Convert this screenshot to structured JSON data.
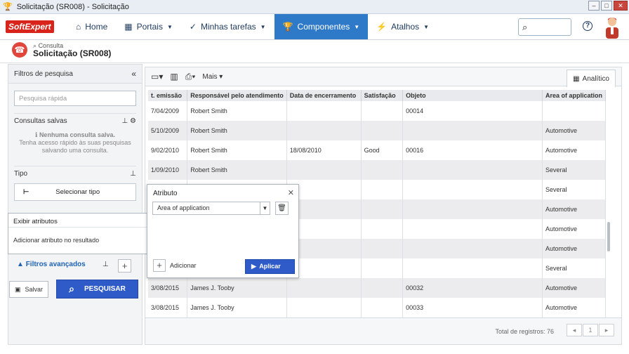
{
  "window": {
    "title": "Solicitação (SR008) - Solicitação"
  },
  "nav": {
    "logo": "SoftExpert",
    "home": "Home",
    "portais": "Portais",
    "tarefas": "Minhas tarefas",
    "componentes": "Componentes",
    "atalhos": "Atalhos"
  },
  "header": {
    "sub": "Consulta",
    "title": "Solicitação (SR008)"
  },
  "left": {
    "title": "Filtros de pesquisa",
    "quick_placeholder": "Pesquisa rápida",
    "saved": "Consultas salvas",
    "none_saved": "Nenhuma consulta salva.",
    "hint1": "Tenha acesso rápido às suas pesquisas",
    "hint2": "salvando uma consulta.",
    "tipo": "Tipo",
    "select_type": "Selecionar tipo",
    "advanced": "Filtros avançados",
    "save": "Salvar",
    "search": "PESQUISAR"
  },
  "toolbar": {
    "more": "Mais",
    "tab": "Analítico"
  },
  "table": {
    "headers": [
      "t. emissão",
      "Responsável pelo atendimento",
      "Data de encerramento",
      "Satisfação",
      "Objeto",
      "Area of application"
    ],
    "rows": [
      [
        "7/04/2009",
        "Robert Smith",
        "",
        "",
        "00014",
        ""
      ],
      [
        "5/10/2009",
        "Robert Smith",
        "",
        "",
        "",
        "Automotive"
      ],
      [
        "9/02/2010",
        "Robert Smith",
        "18/08/2010",
        "Good",
        "00016",
        "Automotive"
      ],
      [
        "1/09/2010",
        "Robert Smith",
        "",
        "",
        "",
        "Several"
      ],
      [
        "",
        "",
        "",
        "",
        "",
        "Several"
      ],
      [
        "",
        "",
        "",
        "",
        "",
        "Automotive"
      ],
      [
        "",
        "",
        "",
        "",
        "",
        "Automotive"
      ],
      [
        "",
        "",
        "",
        "",
        "",
        "Automotive"
      ],
      [
        "",
        "",
        "",
        "",
        "",
        "Several"
      ],
      [
        "3/08/2015",
        "James J. Tooby",
        "",
        "",
        "00032",
        "Automotive"
      ],
      [
        "3/08/2015",
        "James J. Tooby",
        "",
        "",
        "00033",
        "Automotive"
      ]
    ]
  },
  "footer": {
    "total": "Total de registros: 76",
    "page": "1"
  },
  "attr_dialog": {
    "title": "Atributo",
    "value": "Area of application",
    "add": "Adicionar",
    "apply": "Aplicar"
  },
  "exib_dialog": {
    "title": "Exibir atributos",
    "body": "Adicionar atributo no resultado"
  }
}
